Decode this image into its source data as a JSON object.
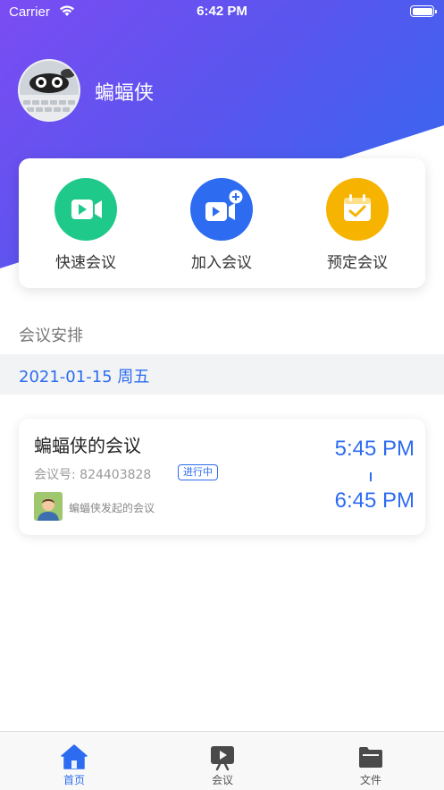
{
  "status_bar": {
    "carrier": "Carrier",
    "time": "6:42 PM"
  },
  "profile": {
    "username": "蝙蝠侠"
  },
  "actions": [
    {
      "label": "快速会议",
      "icon": "video-camera-icon",
      "color": "#1ec98a"
    },
    {
      "label": "加入会议",
      "icon": "join-video-plus-icon",
      "color": "#2d6cf0"
    },
    {
      "label": "预定会议",
      "icon": "calendar-check-icon",
      "color": "#f6b300"
    }
  ],
  "schedule": {
    "section_title": "会议安排",
    "date": "2021-01-15 周五",
    "meeting": {
      "title": "蝙蝠侠的会议",
      "meeting_id": "会议号: 824403828",
      "status": "进行中",
      "host_text": "蝙蝠侠发起的会议",
      "start_time": "5:45 PM",
      "end_time": "6:45 PM"
    }
  },
  "tabbar": {
    "tabs": [
      {
        "label": "首页",
        "icon": "home-icon"
      },
      {
        "label": "会议",
        "icon": "meeting-screen-icon"
      },
      {
        "label": "文件",
        "icon": "folder-icon"
      }
    ],
    "active_color": "#2d6cf0",
    "inactive_color": "#555555"
  },
  "colors": {
    "accent": "#2d6cf0",
    "gradient_start": "#7b4cf3",
    "gradient_end": "#2f6bf0"
  }
}
